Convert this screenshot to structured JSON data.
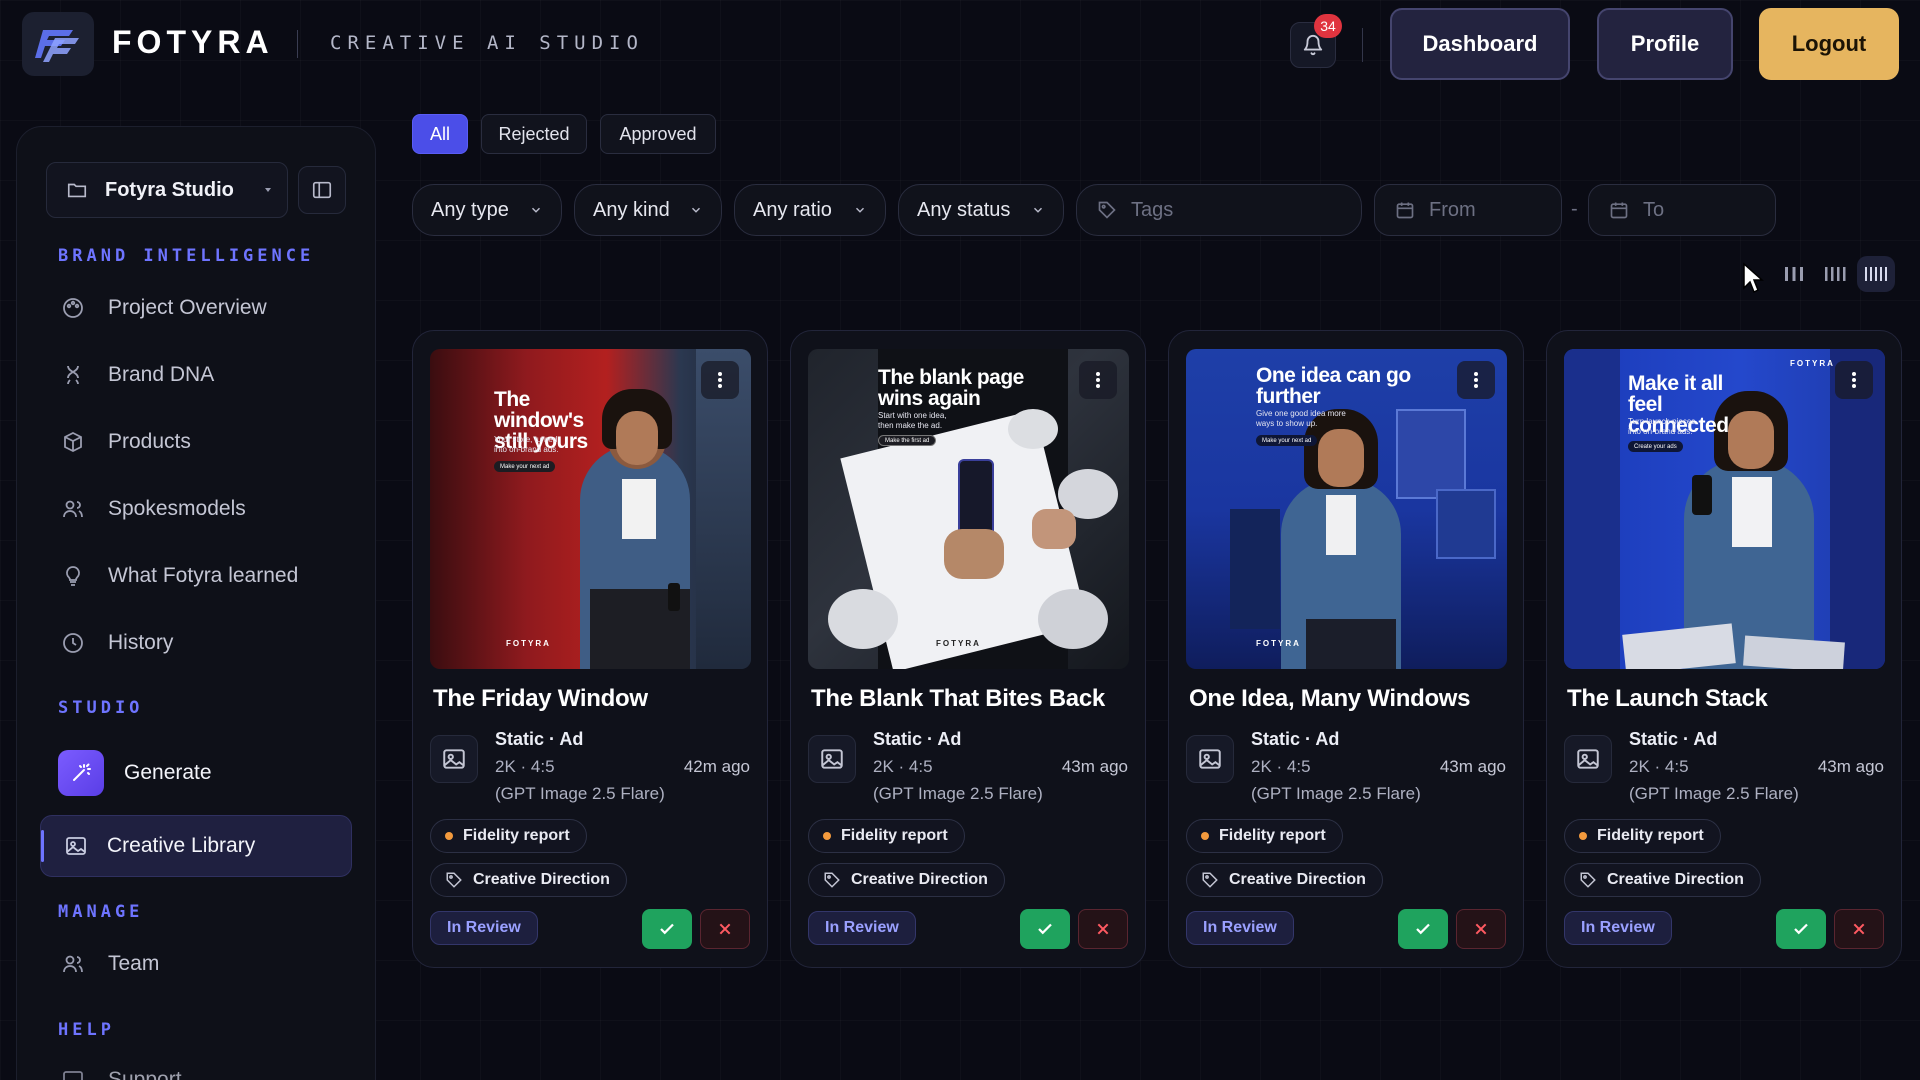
{
  "brand": {
    "name": "FOTYRA",
    "tagline": "CREATIVE AI STUDIO",
    "logo_icon": "fotyra-logo-icon"
  },
  "header": {
    "notifications_count": "34",
    "buttons": {
      "dashboard": "Dashboard",
      "profile": "Profile",
      "logout": "Logout"
    },
    "colors": {
      "logout": "#e6b55f",
      "nav_button": "#23233f"
    }
  },
  "sidebar": {
    "studio_selector": "Fotyra Studio",
    "sections": {
      "brand_intelligence": "BRAND INTELLIGENCE",
      "studio": "STUDIO",
      "manage": "MANAGE",
      "help": "HELP"
    },
    "brand_items": [
      {
        "label": "Project Overview",
        "icon": "palette-icon"
      },
      {
        "label": "Brand DNA",
        "icon": "dna-icon"
      },
      {
        "label": "Products",
        "icon": "box-icon"
      },
      {
        "label": "Spokesmodels",
        "icon": "users-icon"
      },
      {
        "label": "What Fotyra learned",
        "icon": "lightbulb-icon"
      },
      {
        "label": "History",
        "icon": "clock-icon"
      }
    ],
    "studio_items": {
      "generate": "Generate",
      "creative_library": "Creative Library"
    },
    "manage_items": {
      "team": "Team"
    },
    "help_items": {
      "support": "Support"
    },
    "accent_color": "#6e74ff"
  },
  "filters": {
    "tabs": [
      "All",
      "Rejected",
      "Approved"
    ],
    "active_tab": "All",
    "selects": {
      "type": "Any type",
      "kind": "Any kind",
      "ratio": "Any ratio",
      "status": "Any status"
    },
    "tags_placeholder": "Tags",
    "from_placeholder": "From",
    "to_placeholder": "To",
    "range_separator": "-",
    "view_modes": [
      "columns-3-icon",
      "columns-4-icon",
      "columns-5-icon"
    ],
    "active_view": "columns-5-icon"
  },
  "cards": [
    {
      "title": "The Friday Window",
      "type": "Static · Ad",
      "resolution": "2K · 4:5",
      "model": "(GPT Image 2.5 Flare)",
      "time": "42m ago",
      "image_headline": "The window's still yours",
      "image_sub": "Your store, turned into on-brand ads.",
      "image_cta": "Make your next ad",
      "image_watermark": "FOTYRA",
      "chip_fidelity": "Fidelity report",
      "chip_direction": "Creative Direction",
      "status": "In Review"
    },
    {
      "title": "The Blank That Bites Back",
      "type": "Static · Ad",
      "resolution": "2K · 4:5",
      "model": "(GPT Image 2.5 Flare)",
      "time": "43m ago",
      "image_headline": "The blank page wins again",
      "image_sub": "Start with one idea, then make the ad.",
      "image_cta": "Make the first ad",
      "image_watermark": "FOTYRA",
      "chip_fidelity": "Fidelity report",
      "chip_direction": "Creative Direction",
      "status": "In Review"
    },
    {
      "title": "One Idea, Many Windows",
      "type": "Static · Ad",
      "resolution": "2K · 4:5",
      "model": "(GPT Image 2.5 Flare)",
      "time": "43m ago",
      "image_headline": "One idea can go further",
      "image_sub": "Give one good idea more ways to show up.",
      "image_cta": "Make your next ad",
      "image_watermark": "FOTYRA",
      "chip_fidelity": "Fidelity report",
      "chip_direction": "Creative Direction",
      "status": "In Review"
    },
    {
      "title": "The Launch Stack",
      "type": "Static · Ad",
      "resolution": "2K · 4:5",
      "model": "(GPT Image 2.5 Flare)",
      "time": "43m ago",
      "image_headline": "Make it all feel connected",
      "image_sub": "Turn launch pieces into on-brand ads.",
      "image_cta": "Create your ads",
      "image_watermark": "FOTYRA",
      "chip_fidelity": "Fidelity report",
      "chip_direction": "Creative Direction",
      "status": "In Review"
    }
  ]
}
